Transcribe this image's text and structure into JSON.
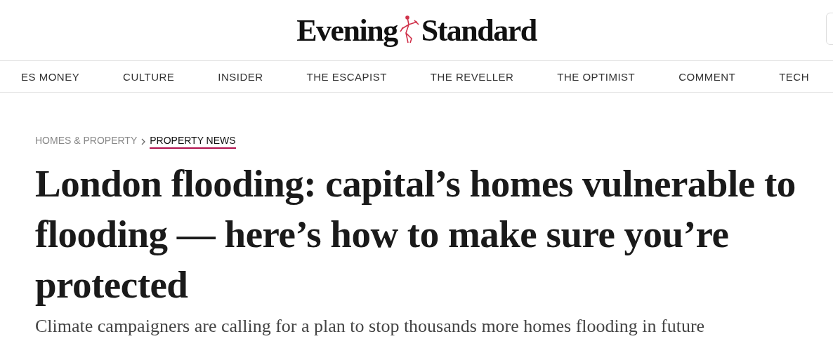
{
  "logo": {
    "left": "Evening",
    "right": "Standard"
  },
  "nav": [
    {
      "label": "ES MONEY"
    },
    {
      "label": "CULTURE"
    },
    {
      "label": "INSIDER"
    },
    {
      "label": "THE ESCAPIST"
    },
    {
      "label": "THE REVELLER"
    },
    {
      "label": "THE OPTIMIST"
    },
    {
      "label": "COMMENT"
    },
    {
      "label": "TECH"
    }
  ],
  "breadcrumb": [
    {
      "label": "HOMES & PROPERTY",
      "selected": false
    },
    {
      "label": "PROPERTY NEWS",
      "selected": true
    }
  ],
  "headline": "London flooding: capital’s homes vulnerable to flooding — here’s how to make sure you’re protected",
  "standfirst": "Climate campaigners are calling for a plan to stop thousands more homes flooding in future"
}
